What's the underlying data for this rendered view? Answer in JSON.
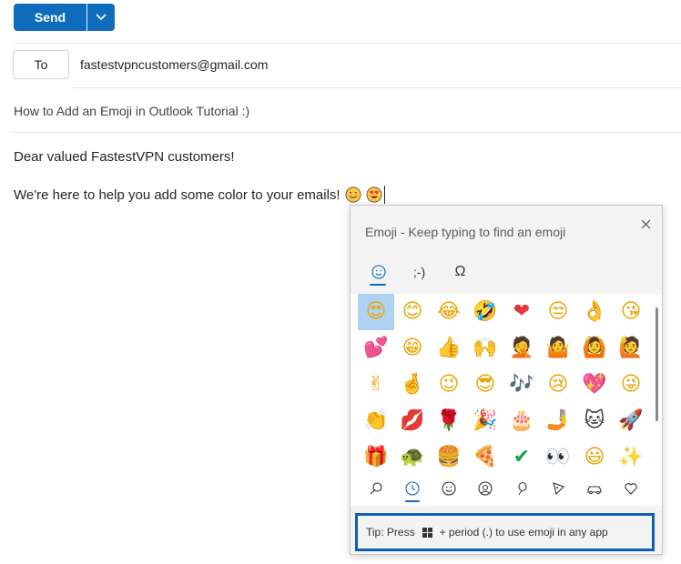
{
  "toolbar": {
    "send_label": "Send"
  },
  "compose": {
    "to_label": "To",
    "to_value": "fastestvpncustomers@gmail.com",
    "subject": "How to Add an Emoji in Outlook Tutorial :)",
    "greeting": "Dear valued FastestVPN customers!",
    "body": "We're here to help you add some color to your emails!"
  },
  "emoji_panel": {
    "title": "Emoji - Keep typing to find an emoji",
    "tabs": [
      {
        "label": "☺",
        "name": "emoji"
      },
      {
        "label": ";-)",
        "name": "kaomoji"
      },
      {
        "label": "Ω",
        "name": "symbols"
      }
    ],
    "tip_prefix": "Tip: Press",
    "tip_suffix": "+ period (.) to use emoji in any app",
    "grid": [
      "😍",
      "😊",
      "😂",
      "🤣",
      "❤",
      "😒",
      "👌",
      "😘",
      "💕",
      "😁",
      "👍",
      "🙌",
      "🤦",
      "🤷",
      "🙆",
      "🙋",
      "✌",
      "🤞",
      "😉",
      "😎",
      "🎶",
      "😢",
      "💖",
      "😜",
      "👏",
      "💋",
      "🌹",
      "🎉",
      "🎂",
      "🤳",
      "🐱",
      "🚀",
      "🎁",
      "🐢",
      "🍔",
      "🍕",
      "✔",
      "👀",
      "😃",
      "✨"
    ],
    "categories": [
      "search",
      "recent",
      "smiley",
      "people",
      "celebration",
      "food",
      "travel",
      "heart"
    ]
  },
  "colors": {
    "accent": "#0f6cbd",
    "selected": "#aed2f0"
  }
}
